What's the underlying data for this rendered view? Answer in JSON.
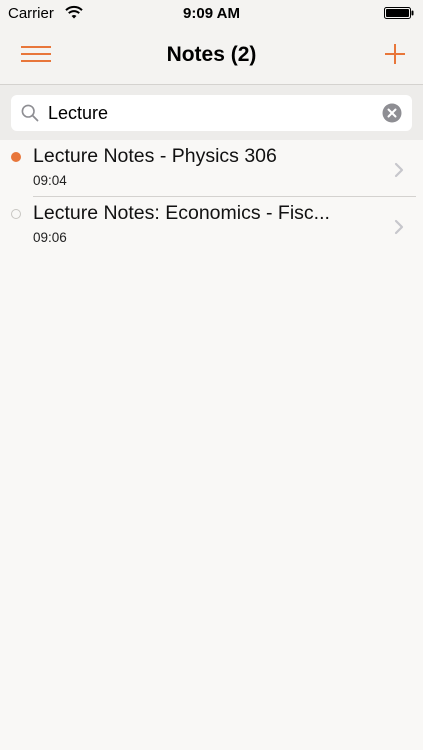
{
  "status_bar": {
    "carrier": "Carrier",
    "time": "9:09 AM"
  },
  "nav": {
    "title": "Notes (2)"
  },
  "search": {
    "value": "Lecture"
  },
  "notes": [
    {
      "title": "Lecture Notes - Physics 306",
      "time": "09:04",
      "indicator": "filled"
    },
    {
      "title": "Lecture Notes: Economics - Fisc...",
      "time": "09:06",
      "indicator": "empty"
    }
  ],
  "colors": {
    "accent": "#e8763a",
    "background": "#f9f8f6",
    "bar_background": "#f4f3f1"
  },
  "icons": {
    "menu": "hamburger-menu-icon",
    "add": "plus-icon",
    "search": "magnifier-icon",
    "clear": "clear-circle-x-icon",
    "disclosure": "chevron-right-icon",
    "wifi": "wifi-icon",
    "battery": "battery-icon"
  }
}
